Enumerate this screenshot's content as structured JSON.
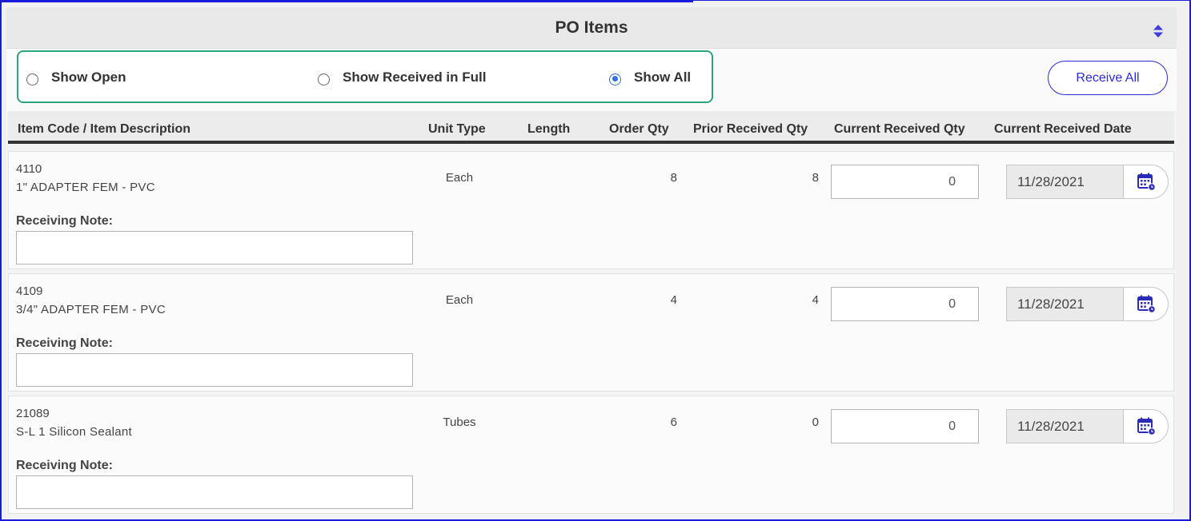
{
  "panel": {
    "title": "PO Items"
  },
  "filters": {
    "options": [
      {
        "label": "Show Open",
        "checked": false
      },
      {
        "label": "Show Received in Full",
        "checked": false
      },
      {
        "label": "Show All",
        "checked": true
      }
    ]
  },
  "actions": {
    "receive_all_label": "Receive All"
  },
  "columns": {
    "item": "Item Code / Item Description",
    "unit_type": "Unit Type",
    "length": "Length",
    "order_qty": "Order Qty",
    "prior_received": "Prior Received Qty",
    "current_received": "Current Received Qty",
    "current_date": "Current Received Date"
  },
  "rows": [
    {
      "code": "4110",
      "description": "1\" ADAPTER FEM - PVC",
      "note_label": "Receiving Note:",
      "unit_type": "Each",
      "length": "",
      "order_qty": "8",
      "prior_received": "8",
      "current_received": "0",
      "current_date": "11/28/2021"
    },
    {
      "code": "4109",
      "description": "3/4\" ADAPTER FEM - PVC",
      "note_label": "Receiving Note:",
      "unit_type": "Each",
      "length": "",
      "order_qty": "4",
      "prior_received": "4",
      "current_received": "0",
      "current_date": "11/28/2021"
    },
    {
      "code": "21089",
      "description": "S-L 1 Silicon Sealant",
      "note_label": "Receiving Note:",
      "unit_type": "Tubes",
      "length": "",
      "order_qty": "6",
      "prior_received": "0",
      "current_received": "0",
      "current_date": "11/28/2021"
    }
  ],
  "icons": {
    "sort": "sort-icon",
    "calendar": "calendar-icon"
  },
  "colors": {
    "accent": "#2b2bd8",
    "filter_border": "#2aa57f",
    "frame": "#1a1adf",
    "radio_checked": "#2f6fe0"
  }
}
